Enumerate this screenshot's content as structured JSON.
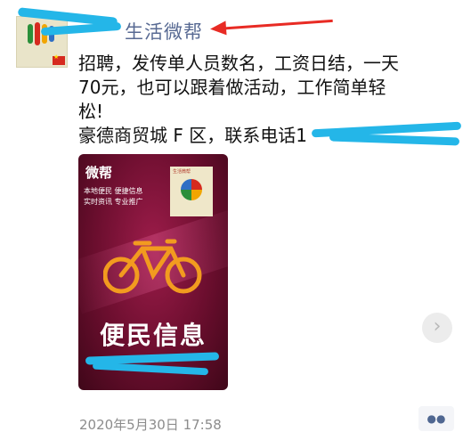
{
  "post": {
    "author_name": "生活微帮",
    "text_lines": [
      "招聘，发传单人员数名，工资日结，一天",
      "70元，也可以跟着做活动，工作简单轻",
      "松!",
      "豪德商贸城 F 区，联系电话1"
    ],
    "timestamp": "2020年5月30日 17:58"
  },
  "image_card": {
    "brand_word": "微帮",
    "slogan_left": [
      "本地便民",
      "实时资讯"
    ],
    "slogan_right": [
      "便捷信息",
      "专业推广"
    ],
    "qr_caption": "生活微帮",
    "title": "便民信息"
  },
  "icons": {
    "side_button": "chevron-right-icon",
    "more_button": "more-dots-icon"
  },
  "colors": {
    "author_name": "#586a93",
    "arrow": "#e82b24",
    "redaction": "#24b6e8",
    "card_bg": "#7a1235"
  }
}
